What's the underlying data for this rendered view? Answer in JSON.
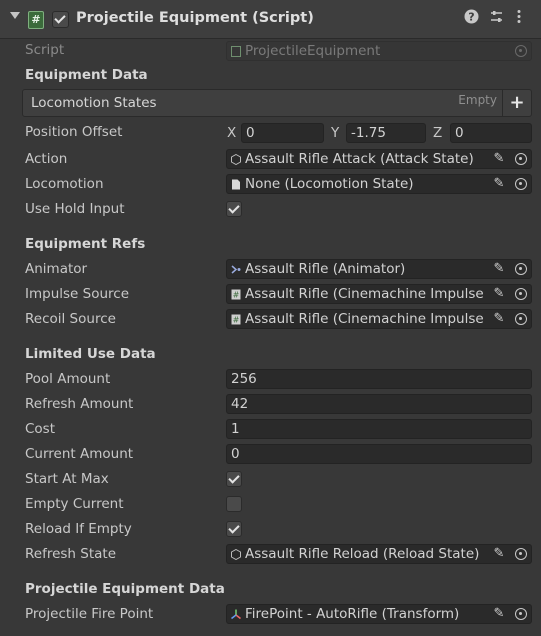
{
  "header": {
    "title": "Projectile Equipment (Script)",
    "enabled": true
  },
  "script": {
    "label": "Script",
    "value": "ProjectileEquipment"
  },
  "sections": {
    "equipment_data": "Equipment Data",
    "equipment_refs": "Equipment Refs",
    "limited_use": "Limited Use Data",
    "projectile_data": "Projectile Equipment Data"
  },
  "locomotion_list": {
    "label": "Locomotion States",
    "empty_text": "Empty",
    "add": "+"
  },
  "position_offset": {
    "label": "Position Offset",
    "x_label": "X",
    "x": "0",
    "y_label": "Y",
    "y": "-1.75",
    "z_label": "Z",
    "z": "0"
  },
  "action": {
    "label": "Action",
    "value": "Assault Rifle Attack (Attack State)"
  },
  "locomotion": {
    "label": "Locomotion",
    "value": "None (Locomotion State)"
  },
  "use_hold_input": {
    "label": "Use Hold Input",
    "checked": true
  },
  "animator": {
    "label": "Animator",
    "value": "Assault Rifle (Animator)"
  },
  "impulse_source": {
    "label": "Impulse Source",
    "value": "Assault Rifle (Cinemachine Impulse S"
  },
  "recoil_source": {
    "label": "Recoil Source",
    "value": "Assault Rifle (Cinemachine Impulse S"
  },
  "pool_amount": {
    "label": "Pool Amount",
    "value": "256"
  },
  "refresh_amount": {
    "label": "Refresh Amount",
    "value": "42"
  },
  "cost": {
    "label": "Cost",
    "value": "1"
  },
  "current_amount": {
    "label": "Current Amount",
    "value": "0"
  },
  "start_at_max": {
    "label": "Start At Max",
    "checked": true
  },
  "empty_current": {
    "label": "Empty Current",
    "checked": false
  },
  "reload_if_empty": {
    "label": "Reload If Empty",
    "checked": true
  },
  "refresh_state": {
    "label": "Refresh State",
    "value": "Assault Rifle Reload (Reload State)"
  },
  "projectile_fire_point": {
    "label": "Projectile Fire Point",
    "value": "FirePoint - AutoRifle (Transform)"
  },
  "icons": [
    "fold-arrow-icon",
    "script-icon",
    "help-icon",
    "presets-icon",
    "kebab-menu-icon",
    "pencil-icon",
    "object-picker-icon",
    "plus-icon",
    "check-icon"
  ]
}
